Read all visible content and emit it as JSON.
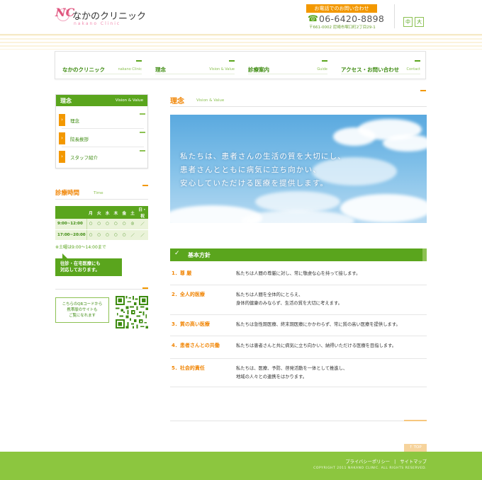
{
  "header": {
    "logo_mark": "NC",
    "clinic_name": "なかのクリニック",
    "clinic_sub": "nakano Clinic",
    "tel_label": "お電話でのお問い合わせ",
    "tel_number": "06-6420-8898",
    "address": "〒661-0002 尼崎市塚口町2丁目29-1",
    "font_medium": "中",
    "font_large": "大"
  },
  "nav": {
    "items": [
      {
        "label": "なかのクリニック",
        "en": "nakano Clinic"
      },
      {
        "label": "理念",
        "en": "Vision & Value"
      },
      {
        "label": "診療案内",
        "en": "Guide"
      },
      {
        "label": "アクセス・お問い合わせ",
        "en": "Contact"
      }
    ]
  },
  "sidebar": {
    "menu_title": "理念",
    "menu_title_en": "Vision & Value",
    "items": [
      {
        "label": "理念"
      },
      {
        "label": "院長挨拶"
      },
      {
        "label": "スタッフ紹介"
      }
    ],
    "hours": {
      "title": "診療時間",
      "title_en": "Time",
      "days": [
        "月",
        "火",
        "水",
        "木",
        "金",
        "土",
        "日・祝"
      ],
      "rows": [
        {
          "time": "9:00~12:00",
          "marks": [
            "○",
            "○",
            "○",
            "○",
            "○",
            "◎",
            "／"
          ]
        },
        {
          "time": "17:00~20:00",
          "marks": [
            "○",
            "○",
            "○",
            "○",
            "○",
            "／",
            "／"
          ]
        }
      ],
      "note": "※土曜は9:00～14:00まで"
    },
    "homecare": {
      "line1": "往診・在宅医療にも",
      "line2": "対応しております。"
    },
    "qr": {
      "line1": "こちらのQRコードから",
      "line2": "携帯版のサイトも",
      "line3": "ご覧になれます"
    }
  },
  "main": {
    "title": "理念",
    "title_en": "Vision & Value",
    "hero": {
      "line1": "私たちは、患者さんの生活の質を大切にし、",
      "line2": "患者さんとともに病気に立ち向かい、",
      "line3": "安心していただける医療を提供します。"
    },
    "policy_title": "基本方針",
    "policies": [
      {
        "num": "1．尊  厳",
        "desc1": "私たちは人間の尊厳に対し、常に敬虔な心を持って接します。",
        "desc2": ""
      },
      {
        "num": "2．全人的医療",
        "desc1": "私たちは人間を全体的にとらえ、",
        "desc2": "身体的健康のみならず、生活の質を大切に考えます。"
      },
      {
        "num": "3．質の高い医療",
        "desc1": "私たちは急性期医療、終末期医療にかかわらず、常に質の高い医療を提供します。",
        "desc2": ""
      },
      {
        "num": "4．患者さんとの共働",
        "desc1": "私たちは患者さんと共に病気に立ち向かい、納得いただける医療を目指します。",
        "desc2": ""
      },
      {
        "num": "5．社会的責任",
        "desc1": "私たちは、医療、予防、啓発活動を一体として推進し、",
        "desc2": "地域の人々との連携をはかります。"
      }
    ]
  },
  "footer": {
    "to_top": "↑ TOP",
    "privacy": "プライバシーポリシー",
    "separator": "|",
    "sitemap": "サイトマップ",
    "copyright": "COPYRIGHT 2011 NAKANO CLINIC. ALL RIGHTS RESERVED."
  },
  "colors": {
    "accent_green": "#5aa51d",
    "accent_orange": "#f39800",
    "footer_green": "#8cc63f"
  }
}
